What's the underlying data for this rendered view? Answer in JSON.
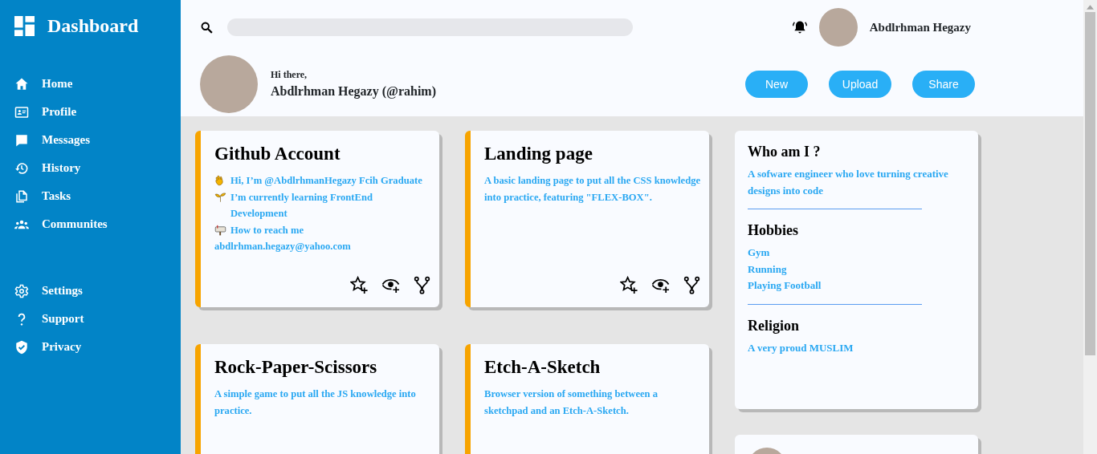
{
  "sidebar": {
    "title": "Dashboard",
    "items": [
      {
        "label": "Home"
      },
      {
        "label": "Profile"
      },
      {
        "label": "Messages"
      },
      {
        "label": "History"
      },
      {
        "label": "Tasks"
      },
      {
        "label": "Communites"
      }
    ],
    "bottom_items": [
      {
        "label": "Settings"
      },
      {
        "label": "Support"
      },
      {
        "label": "Privacy"
      }
    ]
  },
  "header": {
    "user_name": "Abdlrhman Hegazy",
    "greeting": "Hi there,",
    "display_name": "Abdlrhman Hegazy (@rahim)",
    "buttons": [
      "New",
      "Upload",
      "Share"
    ]
  },
  "projects": [
    {
      "title": "Github Account",
      "actions": true,
      "lines": [
        {
          "kind": "greeting",
          "text": "Hi, I’m @AbdlrhmanHegazy Fcih Graduate"
        },
        {
          "kind": "learning",
          "text": "I’m currently learning FrontEnd Development"
        },
        {
          "kind": "contact",
          "text": "How to reach me"
        },
        {
          "kind": "plain",
          "text": "abdlrhman.hegazy@yahoo.com"
        }
      ]
    },
    {
      "title": "Landing page",
      "actions": true,
      "lines": [
        {
          "kind": "plain",
          "text": "A basic landing page to put all the CSS knowledge into practice, featuring \"FLEX-BOX\"."
        }
      ]
    },
    {
      "title": "Rock-Paper-Scissors",
      "actions": false,
      "lines": [
        {
          "kind": "plain",
          "text": "A simple game to put all the JS knowledge into practice."
        }
      ]
    },
    {
      "title": "Etch-A-Sketch",
      "actions": false,
      "lines": [
        {
          "kind": "plain",
          "text": "Browser version of something between a sketchpad and an Etch-A-Sketch."
        }
      ]
    }
  ],
  "about": {
    "sections": [
      {
        "heading": "Who am I ?",
        "lines": [
          "A sofware engineer who love turning creative designs into code"
        ]
      },
      {
        "heading": "Hobbies",
        "lines": [
          "Gym",
          "Running",
          "Playing Football"
        ]
      },
      {
        "heading": "Religion",
        "lines": [
          "A very proud MUSLIM"
        ]
      }
    ]
  }
}
